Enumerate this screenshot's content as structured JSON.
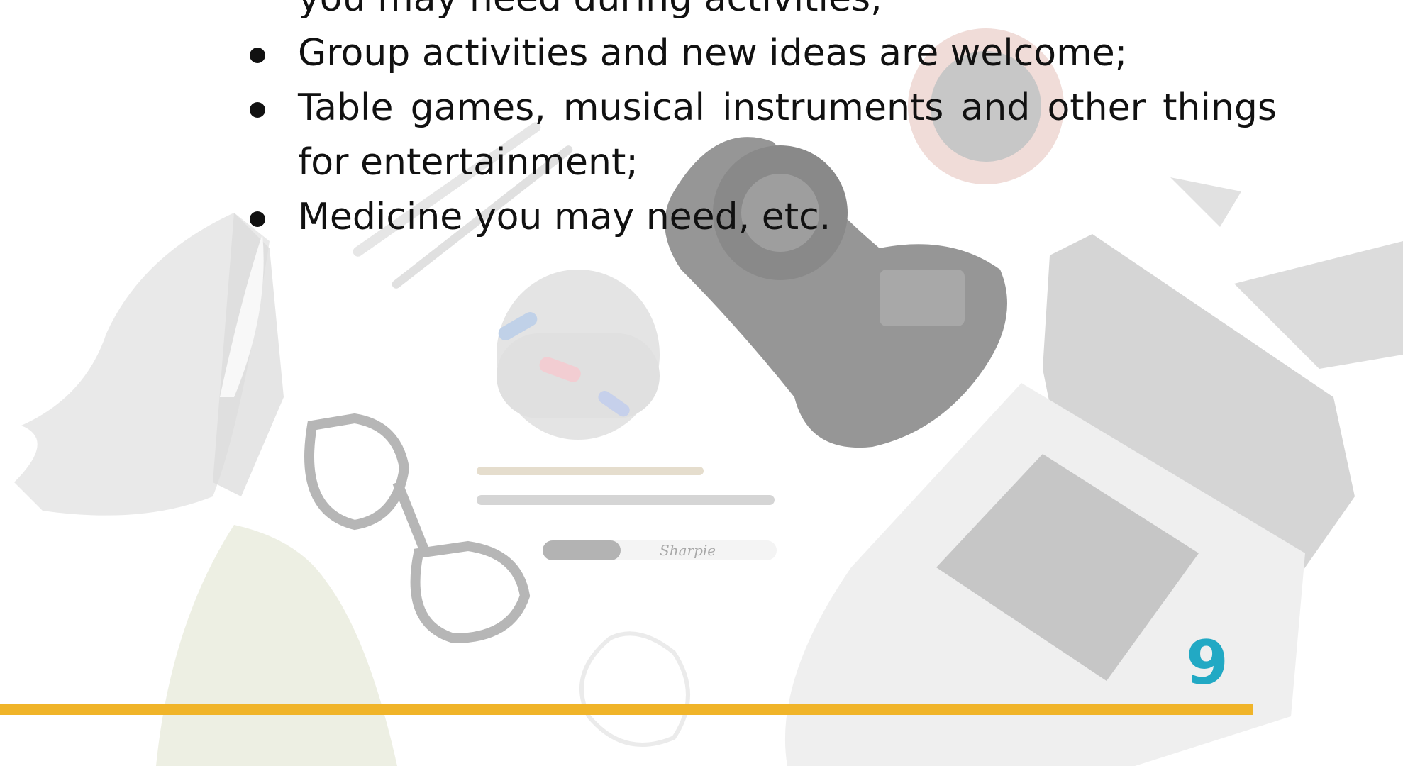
{
  "page": {
    "bullets": [
      {
        "text": "you may need during activities;",
        "continuation": true
      },
      {
        "text": "Group activities and new ideas are welcome;",
        "continuation": false
      },
      {
        "text": "Table games, musical instruments and other things for entertainment;",
        "continuation": false
      },
      {
        "text": "Medicine you may need, etc.",
        "continuation": false
      }
    ],
    "page_number": "9",
    "sharpie_brand": "Sharpie",
    "colors": {
      "page_number": "#22a9c4",
      "footer_rule": "#f0b429",
      "text": "#111111"
    }
  }
}
